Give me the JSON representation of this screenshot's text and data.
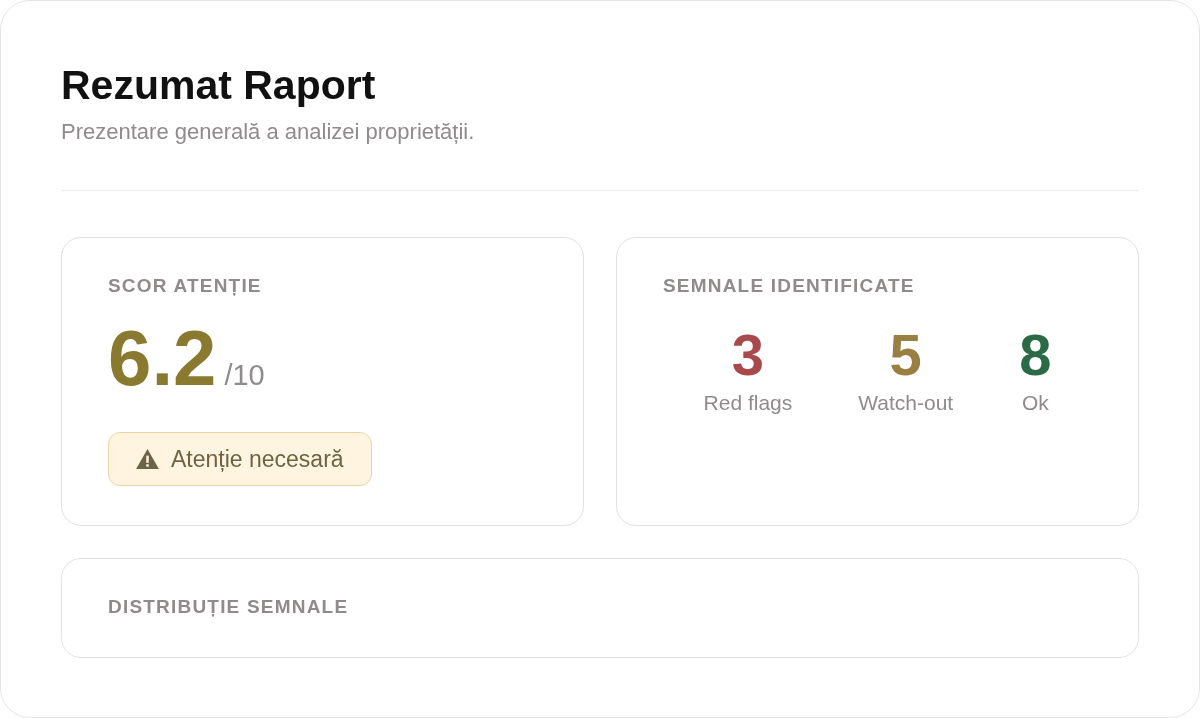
{
  "header": {
    "title": "Rezumat Raport",
    "subtitle": "Prezentare generală a analizei proprietății."
  },
  "score_card": {
    "label": "SCOR ATENȚIE",
    "score": "6.2",
    "scale": "/10",
    "badge": {
      "kind": "warning",
      "text": "Atenție necesară"
    }
  },
  "signals_card": {
    "label": "SEMNALE IDENTIFICATE",
    "stats": [
      {
        "value": "3",
        "label": "Red flags",
        "color": "#a84a4c"
      },
      {
        "value": "5",
        "label": "Watch-out",
        "color": "#9a7f42"
      },
      {
        "value": "8",
        "label": "Ok",
        "color": "#2a6a46"
      }
    ]
  },
  "distribution_card": {
    "label": "DISTRIBUȚIE SEMNALE"
  }
}
